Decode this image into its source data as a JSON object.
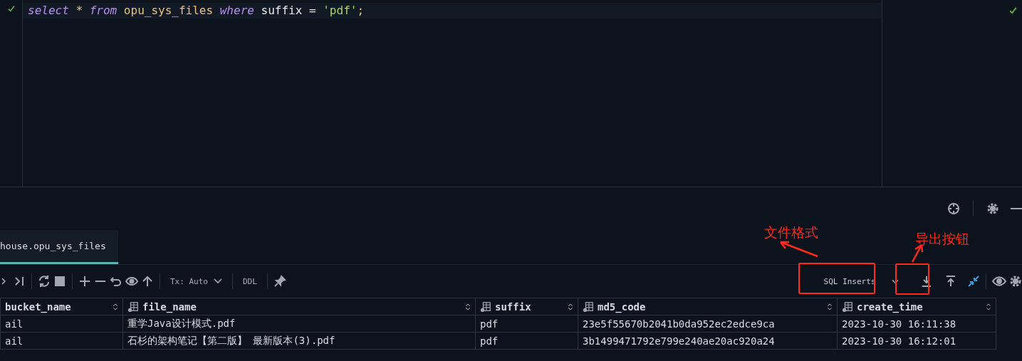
{
  "editor": {
    "lines": [
      {
        "tokens": [
          {
            "text": "select",
            "kind": "keyword"
          },
          {
            "text": " * ",
            "kind": "operator"
          },
          {
            "text": "from",
            "kind": "keyword"
          },
          {
            "text": " opu_sys_files ",
            "kind": "identifier"
          },
          {
            "text": "where",
            "kind": "keyword"
          },
          {
            "text": " suffix = ",
            "kind": "plain"
          },
          {
            "text": "'pdf'",
            "kind": "string"
          },
          {
            "text": ";",
            "kind": "identifier"
          }
        ]
      }
    ]
  },
  "result_tabs": [
    {
      "label": "house.opu_sys_files",
      "selected": true
    }
  ],
  "toolbar": {
    "tx_mode": "Tx: Auto",
    "ddl": "DDL",
    "export_format": "SQL Inserts"
  },
  "table": {
    "columns": [
      "bucket_name",
      "file_name",
      "suffix",
      "md5_code",
      "create_time"
    ],
    "rows": [
      [
        "ail",
        "重学Java设计模式.pdf",
        "pdf",
        "23e5f55670b2041b0da952ec2edce9ca",
        "2023-10-30 16:11:38"
      ],
      [
        "ail",
        "石杉的架构笔记【第二版】 最新版本(3).pdf",
        "pdf",
        "3b1499471792e799e240ae20ac920a24",
        "2023-10-30 16:12:01"
      ]
    ]
  },
  "annotations": [
    {
      "text": "文件格式"
    },
    {
      "text": "导出按钮"
    }
  ]
}
